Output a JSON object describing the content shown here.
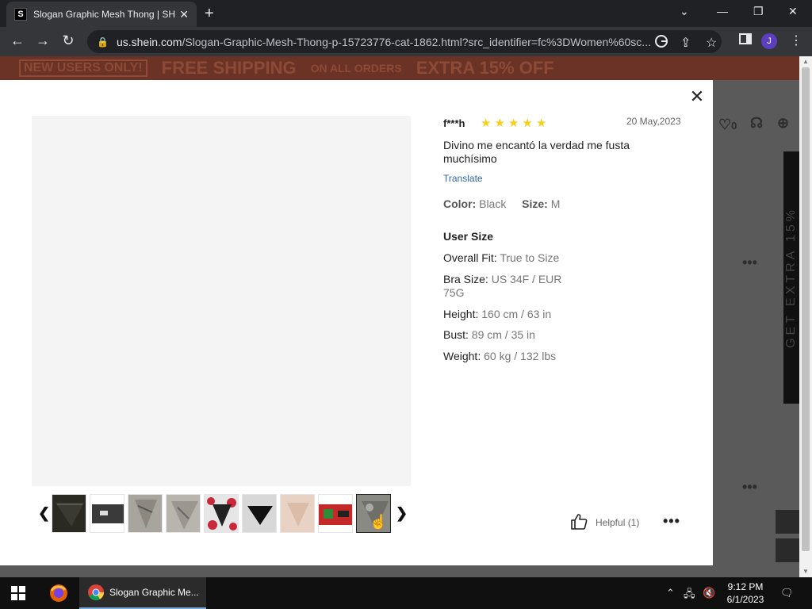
{
  "browser": {
    "tab_title": "Slogan Graphic Mesh Thong | SH",
    "tab_favicon": "S",
    "url_host": "us.shein.com",
    "url_path": "/Slogan-Graphic-Mesh-Thong-p-15723776-cat-1862.html?src_identifier=fc%3DWomen%60sc...",
    "profile_initial": "J"
  },
  "background_page": {
    "banner_new_users": "NEW USERS ONLY!",
    "banner_shipping": "FREE SHIPPING",
    "banner_orders": "ON ALL ORDERS",
    "banner_extra": "EXTRA 15% OFF",
    "side_vertical": "GET EXTRA 15%",
    "wishlist_count": "0"
  },
  "review": {
    "reviewer": "f***h",
    "rating": 5,
    "stars": [
      "★",
      "★",
      "★",
      "★",
      "★"
    ],
    "date": "20 May,2023",
    "text": "Divino me encantó la verdad me fusta muchísimo",
    "translate_label": "Translate",
    "color_label": "Color:",
    "color_value": "Black",
    "size_label": "Size:",
    "size_value": "M",
    "user_size_title": "User Size",
    "overall_fit_label": "Overall Fit:",
    "overall_fit_value": "True to Size",
    "bra_size_label": "Bra Size:",
    "bra_size_value": "US 34F / EUR 75G",
    "height_label": "Height:",
    "height_value": "160 cm / 63 in",
    "bust_label": "Bust:",
    "bust_value": "89 cm / 35 in",
    "weight_label": "Weight:",
    "weight_value": "60 kg / 132 lbs",
    "helpful_label": "Helpful (1)",
    "more_label": "•••"
  },
  "thumbnails": {
    "count": 9,
    "active_index": 8
  },
  "taskbar": {
    "chrome_label": "Slogan Graphic Me...",
    "time": "9:12 PM",
    "date": "6/1/2023"
  },
  "colors": {
    "star": "#facf19",
    "translate_link": "#2d68a8",
    "banner_bg": "#6b3326"
  }
}
